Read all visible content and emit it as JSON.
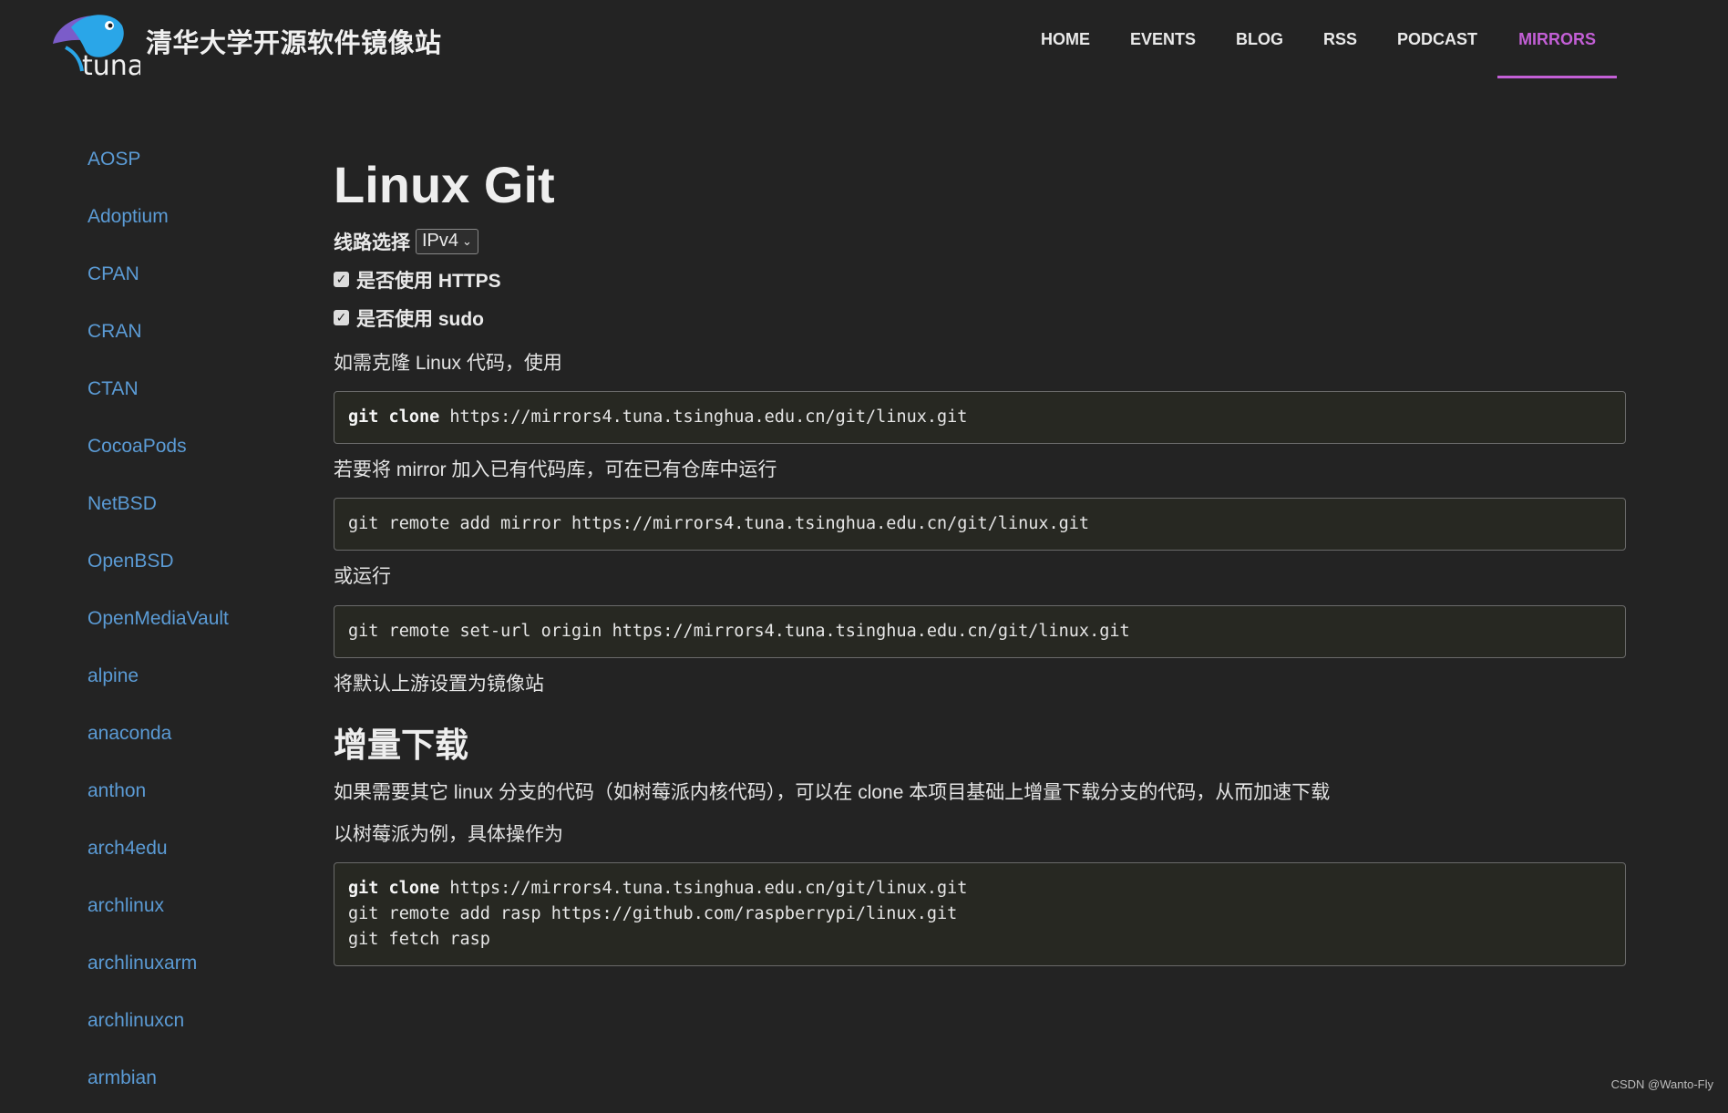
{
  "header": {
    "site_title": "清华大学开源软件镜像站",
    "logo_text": "tuna",
    "nav": [
      {
        "label": "HOME"
      },
      {
        "label": "EVENTS"
      },
      {
        "label": "BLOG"
      },
      {
        "label": "RSS"
      },
      {
        "label": "PODCAST"
      },
      {
        "label": "MIRRORS",
        "active": true
      }
    ],
    "accent_color": "#c35fd6"
  },
  "sidebar": {
    "items": [
      {
        "label": "AOSP"
      },
      {
        "label": "Adoptium"
      },
      {
        "label": "CPAN"
      },
      {
        "label": "CRAN"
      },
      {
        "label": "CTAN"
      },
      {
        "label": "CocoaPods"
      },
      {
        "label": "NetBSD"
      },
      {
        "label": "OpenBSD"
      },
      {
        "label": "OpenMediaVault"
      },
      {
        "label": "alpine"
      },
      {
        "label": "anaconda"
      },
      {
        "label": "anthon"
      },
      {
        "label": "arch4edu"
      },
      {
        "label": "archlinux"
      },
      {
        "label": "archlinuxarm"
      },
      {
        "label": "archlinuxcn"
      },
      {
        "label": "armbian"
      }
    ],
    "link_color": "#5b9bd5"
  },
  "main": {
    "title": "Linux Git",
    "route_label": "线路选择",
    "route_value": "IPv4",
    "https_label": "是否使用 HTTPS",
    "https_checked": true,
    "sudo_label": "是否使用 sudo",
    "sudo_checked": true,
    "clone_intro": "如需克隆 Linux 代码，使用",
    "code_clone_kw": "git clone",
    "code_clone_rest": " https://mirrors4.tuna.tsinghua.edu.cn/git/linux.git",
    "mirror_intro": "若要将 mirror 加入已有代码库，可在已有仓库中运行",
    "code_remote_add": "git remote add mirror https://mirrors4.tuna.tsinghua.edu.cn/git/linux.git",
    "or_run": "或运行",
    "code_set_url": "git remote set-url origin https://mirrors4.tuna.tsinghua.edu.cn/git/linux.git",
    "set_default": "将默认上游设置为镜像站",
    "h2_incremental": "增量下载",
    "incremental_desc": "如果需要其它 linux 分支的代码（如树莓派内核代码），可以在 clone 本项目基础上增量下载分支的代码，从而加速下载",
    "example_intro": "以树莓派为例，具体操作为",
    "code_example_line1_kw": "git clone",
    "code_example_line1_rest": " https://mirrors4.tuna.tsinghua.edu.cn/git/linux.git",
    "code_example_line2": "git remote add rasp https://github.com/raspberrypi/linux.git",
    "code_example_line3": "git fetch rasp"
  },
  "watermark": "CSDN @Wanto-Fly"
}
